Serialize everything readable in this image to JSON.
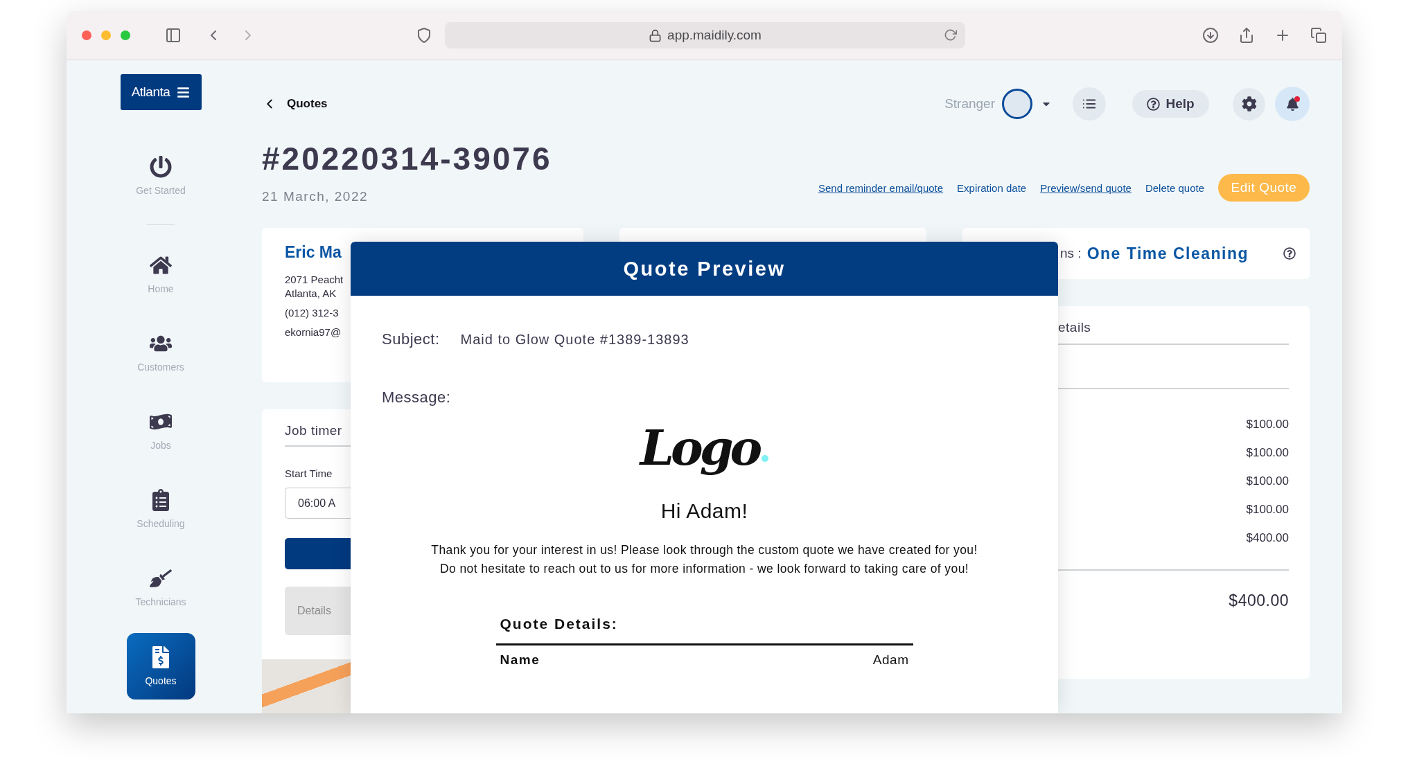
{
  "browser": {
    "url": "app.maidily.com"
  },
  "sidebar": {
    "location_button": "Atlanta",
    "items": [
      {
        "label": "Get Started",
        "kind": "power",
        "selected": false
      },
      {
        "label": "Home",
        "kind": "home",
        "selected": false
      },
      {
        "label": "Customers",
        "kind": "people",
        "selected": false
      },
      {
        "label": "Jobs",
        "kind": "cash",
        "selected": false
      },
      {
        "label": "Scheduling",
        "kind": "clipboard",
        "selected": false
      },
      {
        "label": "Technicians",
        "kind": "cleaner",
        "selected": false
      },
      {
        "label": "Quotes",
        "kind": "quote",
        "selected": true
      }
    ]
  },
  "header": {
    "back_label": "Quotes",
    "user_name": "Stranger",
    "help_label": "Help",
    "unread_notifications": true
  },
  "quote": {
    "number": "#20220314-39076",
    "date": "21 March, 2022",
    "actions": [
      {
        "label": "Send reminder email/quote",
        "underlined": true
      },
      {
        "label": "Expiration date",
        "underlined": false
      },
      {
        "label": "Preview/send quote",
        "underlined": true
      },
      {
        "label": "Delete quote",
        "underlined": false
      }
    ],
    "edit_button": "Edit Quote"
  },
  "customer_card": {
    "name": "Eric Ma",
    "address_lines": [
      "2071 Peacht",
      "Atlanta, AK"
    ],
    "phone": "(012) 312-3",
    "email": "ekornia97@"
  },
  "job_timer_card": {
    "title": "Job timer",
    "start_time_label": "Start Time",
    "start_time_value": "06:00 A",
    "details_button": "Details"
  },
  "service_card": {
    "label": "ns :",
    "value": "One Time Cleaning"
  },
  "details_card": {
    "title": "etails",
    "prices": [
      "$100.00",
      "$100.00",
      "$100.00",
      "$100.00",
      "$400.00"
    ],
    "total": "$400.00"
  },
  "modal": {
    "title": "Quote Preview",
    "subject_label": "Subject:",
    "subject": "Maid to Glow Quote #1389-13893",
    "message_label": "Message:",
    "logo": "Logo",
    "greeting": "Hi Adam!",
    "body_lines": [
      "Thank you for your interest in us! Please look through the custom quote we have created for you!",
      "Do not hesitate to reach out to us for more information - we look forward to taking care of you!"
    ],
    "details_title": "Quote Details:",
    "rows": [
      {
        "label": "Name",
        "value": "Adam"
      }
    ]
  }
}
